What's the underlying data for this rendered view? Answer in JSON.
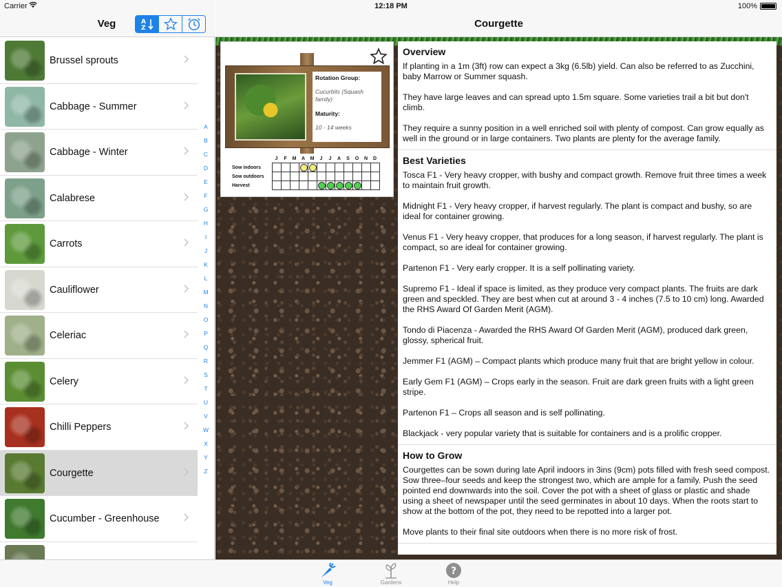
{
  "status": {
    "carrier": "Carrier",
    "time": "12:18 PM",
    "battery": "100%"
  },
  "left_nav": {
    "title": "Veg",
    "segments": [
      "az-sort-icon",
      "star-icon",
      "alarm-icon"
    ]
  },
  "veg_list": [
    {
      "label": "Brussel sprouts",
      "color": "#4e7a36"
    },
    {
      "label": "Cabbage - Summer",
      "color": "#8fb7a6"
    },
    {
      "label": "Cabbage - Winter",
      "color": "#8ea38e"
    },
    {
      "label": "Calabrese",
      "color": "#7da08a"
    },
    {
      "label": "Carrots",
      "color": "#5e9a3c"
    },
    {
      "label": "Cauliflower",
      "color": "#d6d8cf"
    },
    {
      "label": "Celeriac",
      "color": "#9fb08a"
    },
    {
      "label": "Celery",
      "color": "#5b8d33"
    },
    {
      "label": "Chilli Peppers",
      "color": "#a8301e"
    },
    {
      "label": "Courgette",
      "color": "#587a31"
    },
    {
      "label": "Cucumber - Greenhouse",
      "color": "#3f7a2f"
    },
    {
      "label": "",
      "color": "#6a7a55"
    }
  ],
  "alphabet": [
    "A",
    "B",
    "C",
    "D",
    "E",
    "F",
    "G",
    "H",
    "I",
    "J",
    "K",
    "L",
    "M",
    "N",
    "O",
    "P",
    "Q",
    "R",
    "S",
    "T",
    "U",
    "V",
    "W",
    "X",
    "Y",
    "Z"
  ],
  "detail": {
    "title": "Courgette",
    "rotation_label": "Rotation Group:",
    "rotation_value": "Cucurbits (Squash family)",
    "maturity_label": "Maturity:",
    "maturity_value": "10 - 14 weeks",
    "calendar": {
      "months": [
        "J",
        "F",
        "M",
        "A",
        "M",
        "J",
        "J",
        "A",
        "S",
        "O",
        "N",
        "D"
      ],
      "rows": [
        {
          "label": "Sow indoors",
          "marks": [
            0,
            0,
            0,
            1,
            1,
            0,
            0,
            0,
            0,
            0,
            0,
            0
          ]
        },
        {
          "label": "Sow outdoors",
          "marks": [
            0,
            0,
            0,
            0,
            0,
            0,
            0,
            0,
            0,
            0,
            0,
            0
          ]
        },
        {
          "label": "Harvest",
          "marks": [
            0,
            0,
            0,
            0,
            0,
            2,
            2,
            2,
            2,
            2,
            0,
            0
          ]
        }
      ]
    },
    "sections": [
      {
        "heading": "Overview",
        "paragraphs": [
          "If planting in a 1m (3ft) row can expect a 3kg (6.5lb) yield. Can also be referred to as Zucchini, baby Marrow or Summer squash.",
          "They have large leaves and can spread upto 1.5m square. Some varieties trail a bit but don't climb.",
          "They require a sunny position in a well enriched soil with plenty of compost.  Can grow equally as well in the ground or in large containers.  Two plants are plenty for the average family."
        ]
      },
      {
        "heading": "Best Varieties",
        "paragraphs": [
          "Tosca F1 - Very heavy cropper, with bushy and compact growth. Remove fruit three times a week to maintain fruit growth.",
          "Midnight F1 - Very heavy cropper, if harvest regularly.  The plant is compact and bushy, so are ideal for container growing.",
          "Venus F1 - Very heavy cropper, that produces for a long season, if harvest regularly.  The plant is compact, so are ideal for container growing.",
          "Partenon F1 - Very early cropper.  It is a self pollinating variety.",
          "Supremo F1 - Ideal if space is limited, as they produce very compact plants.  The fruits are dark green and speckled.  They are best when cut at around 3 - 4 inches (7.5 to 10 cm) long.  Awarded the RHS Award Of Garden Merit (AGM).",
          "Tondo di Piacenza - Awarded the RHS Award Of Garden Merit (AGM), produced dark green, glossy, spherical fruit.",
          "Jemmer F1 (AGM) – Compact plants which produce many fruit that are bright yellow in colour.",
          "Early Gem F1 (AGM) – Crops early in the season.  Fruit are dark green fruits with a light green stripe.",
          "Partenon F1 – Crops all season and is self pollinating.",
          "Blackjack - very popular variety that is suitable for containers and is a prolific cropper."
        ]
      },
      {
        "heading": "How to Grow",
        "paragraphs": [
          "Courgettes can be sown during late April indoors in 3ins (9cm) pots filled with fresh seed compost. Sow three–four seeds and keep the strongest two, which are ample for a family.  Push the seed pointed end downwards into the soil.  Cover the pot with a sheet of glass or plastic and shade using a sheet of newspaper until the seed germinates in about 10 days.  When the roots start to show at the bottom of the pot, they need to be repotted into a larger pot.",
          "Move plants to their final site outdoors when there is no more risk of frost."
        ]
      }
    ]
  },
  "tabbar": [
    {
      "label": "Veg",
      "icon": "carrot-icon",
      "active": true
    },
    {
      "label": "Gardens",
      "icon": "seedling-icon",
      "active": false
    },
    {
      "label": "Help",
      "icon": "help-icon",
      "active": false
    }
  ],
  "colors": {
    "accent": "#1f82e6",
    "selected_row": "#d9d9d9"
  }
}
